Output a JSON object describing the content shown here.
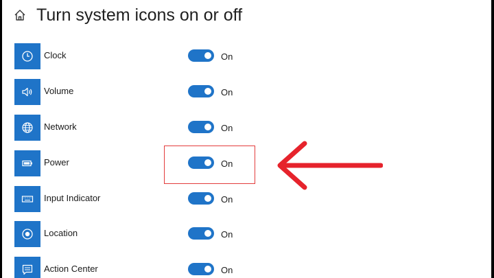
{
  "page": {
    "title": "Turn system icons on or off"
  },
  "colors": {
    "accent": "#1f74c8",
    "annotation": "#e6232c"
  },
  "items": [
    {
      "label": "Clock",
      "state": "On",
      "icon": "clock-icon"
    },
    {
      "label": "Volume",
      "state": "On",
      "icon": "volume-icon"
    },
    {
      "label": "Network",
      "state": "On",
      "icon": "network-icon"
    },
    {
      "label": "Power",
      "state": "On",
      "icon": "power-icon"
    },
    {
      "label": "Input Indicator",
      "state": "On",
      "icon": "input-indicator-icon"
    },
    {
      "label": "Location",
      "state": "On",
      "icon": "location-icon"
    },
    {
      "label": "Action Center",
      "state": "On",
      "icon": "action-center-icon"
    }
  ]
}
